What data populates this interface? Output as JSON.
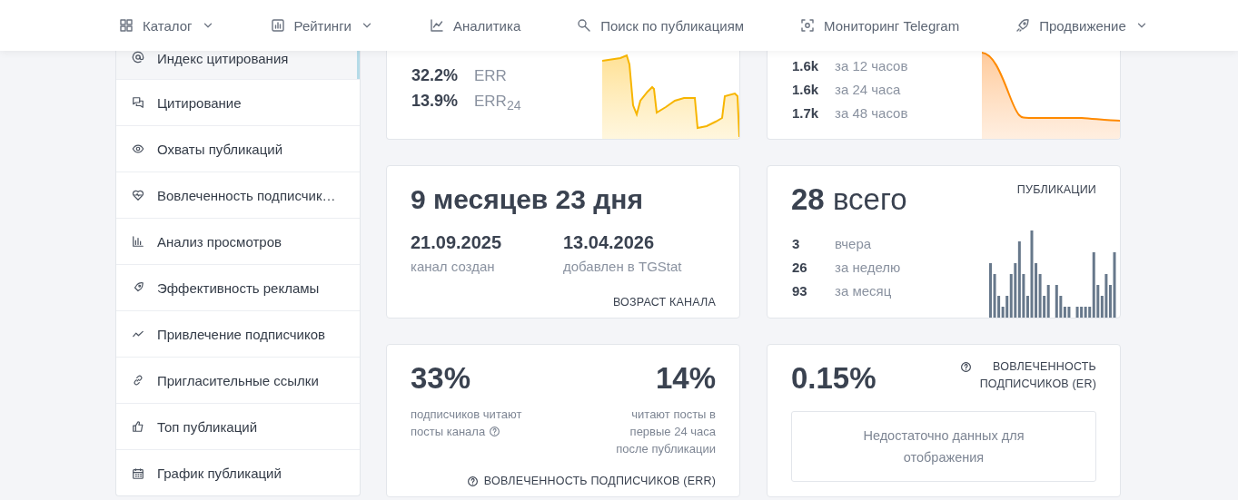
{
  "nav": {
    "items": [
      {
        "label": "Каталог",
        "dropdown": true
      },
      {
        "label": "Рейтинги",
        "dropdown": true
      },
      {
        "label": "Аналитика",
        "dropdown": false
      },
      {
        "label": "Поиск по публикациям",
        "dropdown": false
      },
      {
        "label": "Мониторинг Telegram",
        "dropdown": false
      },
      {
        "label": "Продвижение",
        "dropdown": true
      }
    ]
  },
  "sidebar": {
    "items": [
      {
        "label": "Индекс цитирования",
        "selected": true
      },
      {
        "label": "Цитирование",
        "selected": false
      },
      {
        "label": "Охваты публикаций",
        "selected": false
      },
      {
        "label": "Вовлеченность подписчик…",
        "selected": false
      },
      {
        "label": "Анализ просмотров",
        "selected": false
      },
      {
        "label": "Эффективность рекламы",
        "selected": false
      },
      {
        "label": "Привлечение подписчиков",
        "selected": false
      },
      {
        "label": "Пригласительные ссылки",
        "selected": false
      },
      {
        "label": "Топ публикаций",
        "selected": false
      },
      {
        "label": "График публикаций",
        "selected": false
      }
    ]
  },
  "err_card": {
    "stats": [
      {
        "value": "32.2%",
        "label": "ERR"
      },
      {
        "value": "13.9%",
        "label": "ERR$_{24}$"
      }
    ]
  },
  "views_card": {
    "stats": [
      {
        "value": "1.6k",
        "label": "за 12 часов"
      },
      {
        "value": "1.6k",
        "label": "за 24 часа"
      },
      {
        "value": "1.7k",
        "label": "за 48 часов"
      }
    ]
  },
  "age_card": {
    "title": "9 месяцев 23 дня",
    "dates": [
      {
        "value": "21.09.2025",
        "label": "канал создан"
      },
      {
        "value": "13.04.2026",
        "label": "добавлен в TGStat"
      }
    ],
    "footer": "ВОЗРАСТ КАНАЛА"
  },
  "posts_card": {
    "total": "28",
    "total_label": "всего",
    "label": "ПУБЛИКАЦИИ",
    "stats": [
      {
        "value": "3",
        "label": "вчера"
      },
      {
        "value": "26",
        "label": "за неделю"
      },
      {
        "value": "93",
        "label": "за месяц"
      }
    ]
  },
  "reach_card": {
    "left": {
      "value": "33%",
      "label": "подписчиков читают посты канала"
    },
    "right": {
      "value": "14%",
      "label": "читают посты в первые 24 часа после публикации"
    },
    "footer": "ВОВЛЕЧЕННОСТЬ ПОДПИСЧИКОВ (ERR)"
  },
  "er_card": {
    "value": "0.15%",
    "label": "ВОВЛЕЧЕННОСТЬ ПОДПИСЧИКОВ (ER)",
    "empty_message": "Недостаточно данных для отображения"
  }
}
